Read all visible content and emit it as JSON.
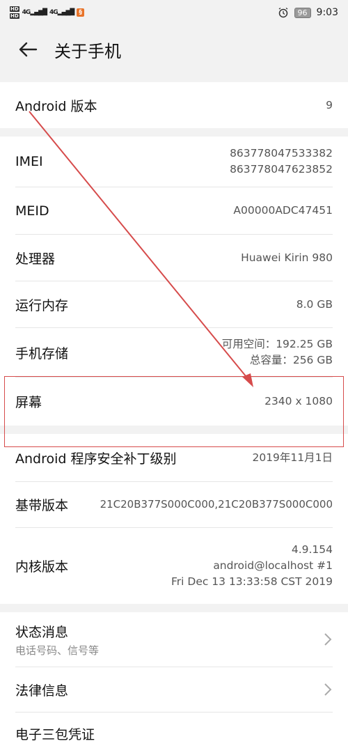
{
  "status_bar": {
    "hd_top": "HD",
    "hd_bottom": "HD",
    "signal_1": "4G",
    "signal_2": "4G",
    "battery": "96",
    "time": "9:03"
  },
  "header": {
    "title": "关于手机"
  },
  "rows": {
    "android_version": {
      "label": "Android 版本",
      "value": "9"
    },
    "imei": {
      "label": "IMEI",
      "value_1": "863778047533382",
      "value_2": "863778047623852"
    },
    "meid": {
      "label": "MEID",
      "value": "A00000ADC47451"
    },
    "processor": {
      "label": "处理器",
      "value": "Huawei Kirin 980"
    },
    "ram": {
      "label": "运行内存",
      "value": "8.0 GB"
    },
    "storage": {
      "label": "手机存储",
      "value_1": "可用空间：192.25  GB",
      "value_2": "总容量：256  GB"
    },
    "screen": {
      "label": "屏幕",
      "value": "2340 x 1080"
    },
    "patch": {
      "label": "Android 程序安全补丁级别",
      "value": "2019年11月1日"
    },
    "baseband": {
      "label": "基带版本",
      "value": "21C20B377S000C000,21C20B377S000C000"
    },
    "kernel": {
      "label": "内核版本",
      "value_1": "4.9.154",
      "value_2": "android@localhost #1",
      "value_3": "Fri Dec 13 13:33:58 CST 2019"
    },
    "status": {
      "label": "状态消息",
      "sublabel": "电话号码、信号等"
    },
    "legal": {
      "label": "法律信息"
    },
    "warranty": {
      "label": "电子三包凭证"
    }
  },
  "colors": {
    "annotation": "#d64b4b",
    "background": "#f2f2f2",
    "card": "#ffffff"
  }
}
